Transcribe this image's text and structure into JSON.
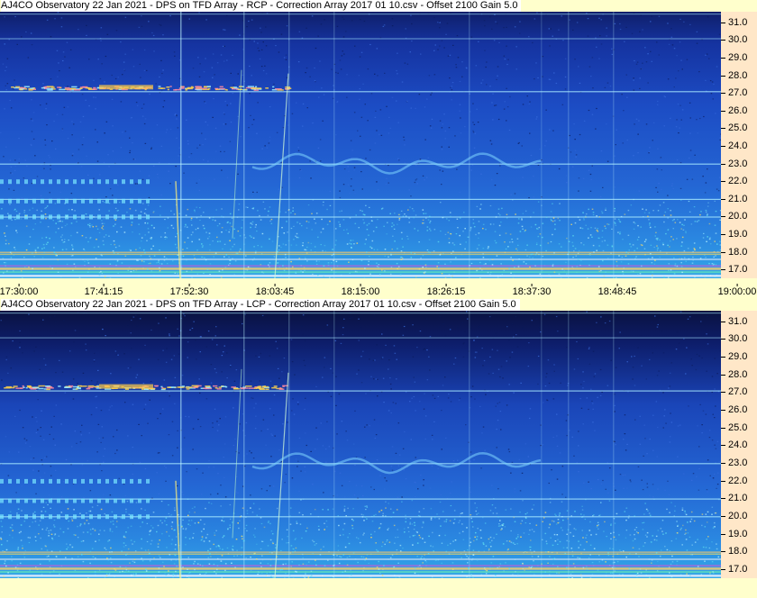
{
  "app": {
    "background_color": "#ffffcc",
    "axis_panel_color": "#ffe7c8"
  },
  "panels": [
    {
      "id": "rcp",
      "title": "AJ4CO Observatory 22 Jan 2021  -  DPS on TFD Array  -  RCP  -  Correction Array 2017 01 10.csv  -  Offset 2100  Gain 5.0",
      "y_ticks": [
        "31.0",
        "30.0",
        "29.0",
        "28.0",
        "27.0",
        "26.0",
        "25.0",
        "24.0",
        "23.0",
        "22.0",
        "21.0",
        "20.0",
        "19.0",
        "18.0",
        "17.0"
      ]
    },
    {
      "id": "lcp",
      "title": "AJ4CO Observatory 22 Jan 2021  -  DPS on TFD Array  -  LCP  -  Correction Array 2017 01 10.csv  -  Offset 2100  Gain 5.0",
      "y_ticks": [
        "31.0",
        "30.0",
        "29.0",
        "28.0",
        "27.0",
        "26.0",
        "25.0",
        "24.0",
        "23.0",
        "22.0",
        "21.0",
        "20.0",
        "19.0",
        "18.0",
        "17.0"
      ]
    }
  ],
  "time_axis": {
    "labels": [
      "17:30:00",
      "17:41:15",
      "17:52:30",
      "18:03:45",
      "18:15:00",
      "18:26:15",
      "18:37:30",
      "18:48:45",
      "19:00:00"
    ]
  },
  "spectrogram": {
    "x_range": [
      "17:30:00",
      "19:00:00"
    ],
    "y_range_mhz": [
      16.5,
      31.6
    ],
    "y_unit": "MHz",
    "colors": {
      "deep": "#0a1a5a",
      "mid": "#1e4fc8",
      "bright": "#2a8de6",
      "cyan": "#33d6e0",
      "hot": "#ffd24a"
    },
    "interference_bands_mhz": [
      31.5,
      30.1,
      27.1,
      23.0,
      21.0,
      20.0,
      18.0,
      17.6,
      17.1,
      16.7
    ],
    "burst_band_mhz": 27.3,
    "burst_time_range": [
      "17:30:00",
      "17:51:00"
    ]
  }
}
